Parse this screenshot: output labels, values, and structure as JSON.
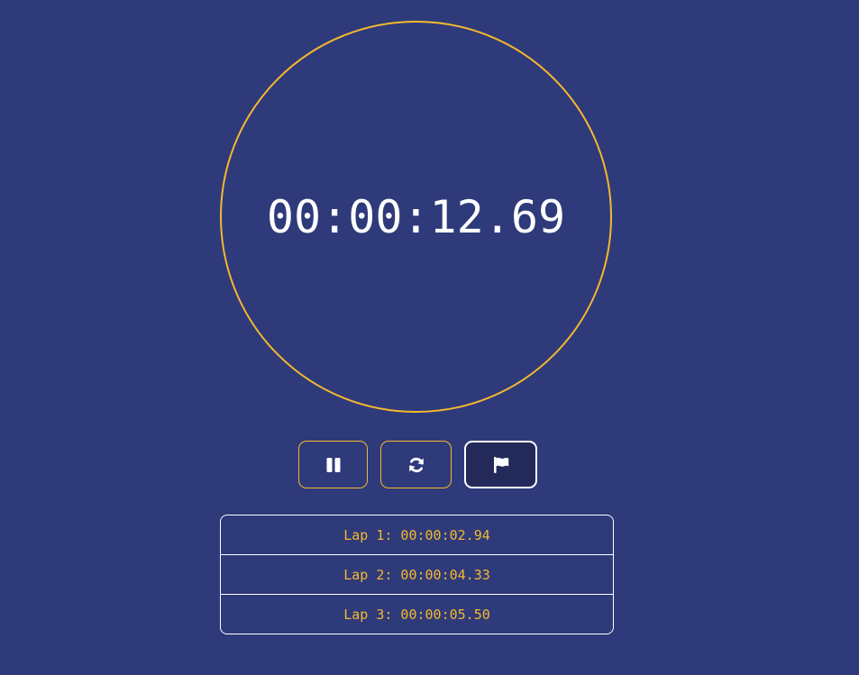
{
  "stopwatch": {
    "time": "00:00:12.69"
  },
  "controls": {
    "pause_icon": "pause-icon",
    "reset_icon": "reset-icon",
    "lap_icon": "flag-icon"
  },
  "laps": [
    {
      "label": "Lap 1: 00:00:02.94"
    },
    {
      "label": "Lap 2: 00:00:04.33"
    },
    {
      "label": "Lap 3: 00:00:05.50"
    }
  ],
  "colors": {
    "background": "#2e3a7a",
    "accent": "#f5b82e",
    "text": "#ffffff"
  }
}
